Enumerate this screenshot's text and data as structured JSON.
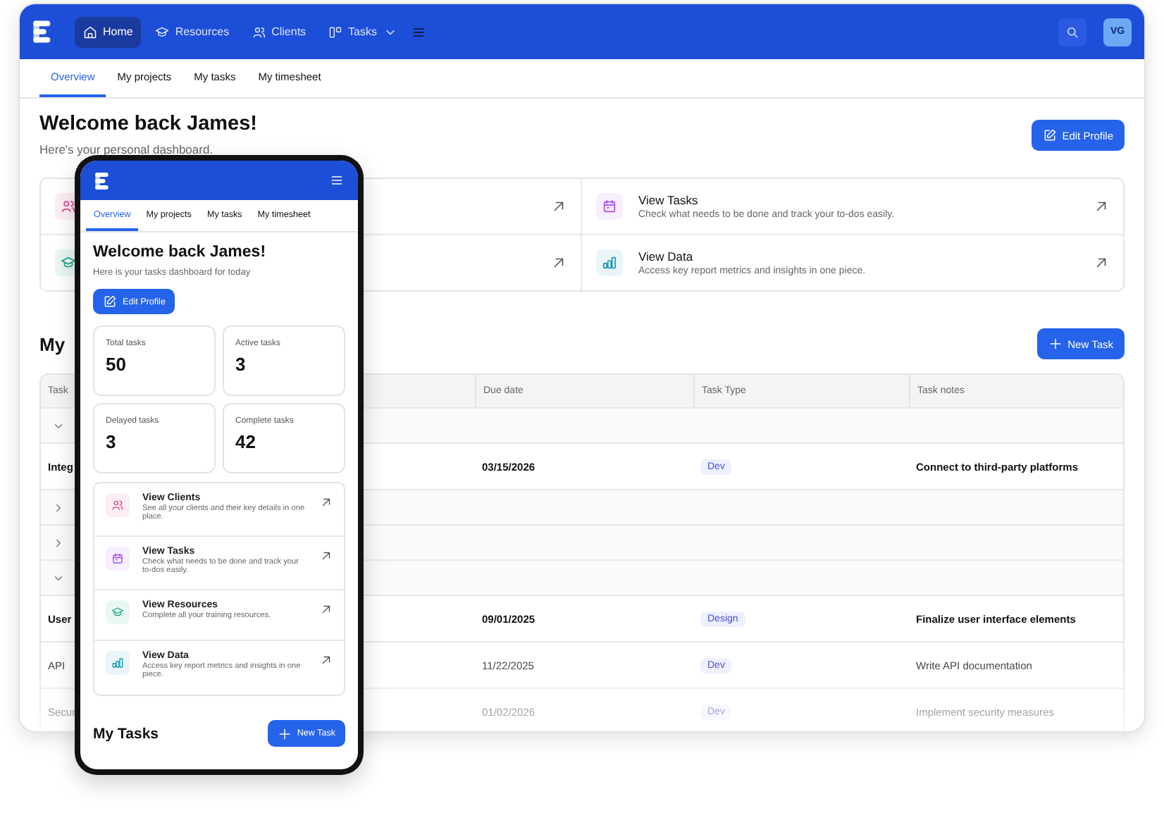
{
  "desktop": {
    "nav": {
      "items": [
        {
          "label": "Home",
          "kind": "home",
          "selected": true,
          "dropdown": false
        },
        {
          "label": "Resources",
          "kind": "cap",
          "selected": false,
          "dropdown": false
        },
        {
          "label": "Clients",
          "kind": "users",
          "selected": false,
          "dropdown": false
        },
        {
          "label": "Tasks",
          "kind": "tasks",
          "selected": false,
          "dropdown": true
        }
      ],
      "avatar": "VG"
    },
    "tabs": [
      {
        "label": "Overview",
        "selected": true
      },
      {
        "label": "My projects",
        "selected": false
      },
      {
        "label": "My tasks",
        "selected": false
      },
      {
        "label": "My timesheet",
        "selected": false
      }
    ],
    "title": "Welcome back James!",
    "subtitle": "Here's your personal dashboard.",
    "edit_button": "Edit Profile",
    "quick_links": [
      {
        "kind": "users",
        "color": "#e0488a"
      },
      {
        "kind": "calendar",
        "color": "#a64df0",
        "title": "View Tasks",
        "description": "Check what needs to be done and track your to-dos easily."
      },
      {
        "kind": "cap",
        "color": "#17a589"
      },
      {
        "kind": "chart",
        "color": "#1199b5",
        "title": "View Data",
        "description": "Access key report metrics and insights in one piece."
      }
    ],
    "tasks_heading": "My",
    "new_task_button": "New Task",
    "table": {
      "columns": [
        "Task",
        "Due date",
        "Task Type",
        "Task notes"
      ],
      "rows": [
        {
          "kind": "group",
          "expanded": true
        },
        {
          "kind": "task",
          "name": "Integ",
          "due": "03/15/2026",
          "type": "Dev",
          "notes": "Connect to third-party platforms",
          "bold": true
        },
        {
          "kind": "group",
          "expanded": false
        },
        {
          "kind": "group",
          "expanded": false
        },
        {
          "kind": "group",
          "expanded": true
        },
        {
          "kind": "task",
          "name": "User",
          "due": "09/01/2025",
          "type": "Design",
          "notes": "Finalize user interface elements",
          "bold": true
        },
        {
          "kind": "task",
          "name": "API",
          "due": "11/22/2025",
          "type": "Dev",
          "notes": "Write API documentation",
          "bold": false
        },
        {
          "kind": "task",
          "name": "Secur",
          "due": "01/02/2026",
          "type": "Dev",
          "notes": "Implement security measures",
          "bold": false
        }
      ]
    }
  },
  "phone": {
    "tabs": [
      {
        "label": "Overview",
        "selected": true
      },
      {
        "label": "My projects",
        "selected": false
      },
      {
        "label": "My tasks",
        "selected": false
      },
      {
        "label": "My timesheet",
        "selected": false
      }
    ],
    "title": "Welcome back James!",
    "subtitle": "Here is your tasks dashboard for today",
    "edit_button": "Edit Profile",
    "stats": [
      {
        "label": "Total tasks",
        "value": "50"
      },
      {
        "label": "Active tasks",
        "value": "3"
      },
      {
        "label": "Delayed tasks",
        "value": "3"
      },
      {
        "label": "Complete tasks",
        "value": "42"
      }
    ],
    "links": [
      {
        "kind": "users",
        "color": "#e0488a",
        "title": "View Clients",
        "description": "See all your clients and their key details in one place."
      },
      {
        "kind": "calendar",
        "color": "#a64df0",
        "title": "View Tasks",
        "description": "Check what needs to be done and track your to-dos easily."
      },
      {
        "kind": "cap",
        "color": "#17a589",
        "title": "View Resources",
        "description": "Complete all your training resources."
      },
      {
        "kind": "chart",
        "color": "#1199b5",
        "title": "View Data",
        "description": "Access key report metrics and insights in one piece."
      }
    ],
    "tasks_heading": "My Tasks",
    "new_task_button": "New Task"
  }
}
